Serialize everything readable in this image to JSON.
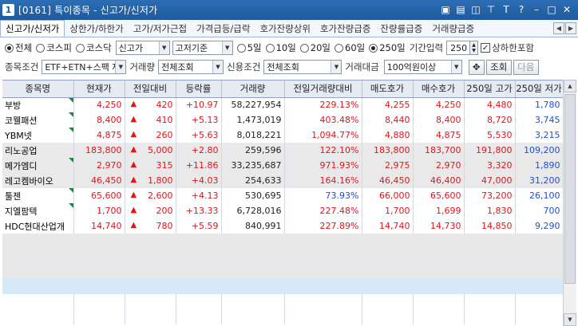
{
  "window": {
    "number": "1",
    "title": "[0161] 특이종목 - 신고가/신저가",
    "title_icons": [
      "monitor-icon",
      "clipboard-icon",
      "split-icon",
      "pin-icon",
      "T",
      "?",
      "minimize-icon",
      "maximize-icon",
      "close-icon"
    ]
  },
  "tabs": [
    {
      "label": "신고가/신저가",
      "active": true
    },
    {
      "label": "상한가/하한가"
    },
    {
      "label": "고가/저가근접"
    },
    {
      "label": "가격급등/급락"
    },
    {
      "label": "호가잔량상위"
    },
    {
      "label": "호가잔량급증"
    },
    {
      "label": "잔량률급증"
    },
    {
      "label": "거래량급증"
    }
  ],
  "filters": {
    "market_radios": [
      {
        "label": "전체",
        "checked": true
      },
      {
        "label": "코스피",
        "checked": false
      },
      {
        "label": "코스닥",
        "checked": false
      }
    ],
    "type_select": "신고가",
    "basis_select": "고저기준",
    "period_radios": [
      {
        "label": "5일",
        "checked": false
      },
      {
        "label": "10일",
        "checked": false
      },
      {
        "label": "20일",
        "checked": false
      },
      {
        "label": "60일",
        "checked": false
      },
      {
        "label": "250일",
        "checked": true
      }
    ],
    "period_input_label": "기간입력",
    "period_input_value": "250",
    "include_limit_label": "상하한포함",
    "include_limit_checked": true,
    "stock_condition_label": "종목조건",
    "stock_condition_value": "ETF+ETN+스팩 제",
    "volume_label": "거래량",
    "volume_value": "전체조회",
    "credit_label": "신용조건",
    "credit_value": "전체조회",
    "amount_label": "거래대금",
    "amount_value": "100억원이상",
    "search_button": "조회",
    "next_button": "다음"
  },
  "table": {
    "columns": [
      "종목명",
      "현재가",
      "전일대비",
      "등락률",
      "거래량",
      "전일거래량대비",
      "매도호가",
      "매수호가",
      "250일 고가",
      "250일 저가"
    ],
    "rows": [
      {
        "name": "부방",
        "price": "4,250",
        "change": "420",
        "rate": "+10.97",
        "volume": "58,227,954",
        "vol_ratio": "229.13%",
        "ask": "4,255",
        "bid": "4,250",
        "high": "4,480",
        "low": "1,780",
        "shade": false,
        "flag": true
      },
      {
        "name": "코웰패션",
        "price": "8,400",
        "change": "410",
        "rate": "+5.13",
        "volume": "1,473,019",
        "vol_ratio": "403.48%",
        "ask": "8,440",
        "bid": "8,400",
        "high": "8,720",
        "low": "3,745",
        "shade": false,
        "flag": true
      },
      {
        "name": "YBM넷",
        "price": "4,875",
        "change": "260",
        "rate": "+5.63",
        "volume": "8,018,221",
        "vol_ratio": "1,094.77%",
        "ask": "4,880",
        "bid": "4,875",
        "high": "5,530",
        "low": "3,215",
        "shade": false,
        "flag": true
      },
      {
        "name": "리노공업",
        "price": "183,800",
        "change": "5,000",
        "rate": "+2.80",
        "volume": "259,596",
        "vol_ratio": "122.10%",
        "ask": "183,800",
        "bid": "183,700",
        "high": "191,800",
        "low": "109,200",
        "shade": true,
        "flag": false
      },
      {
        "name": "메가엠디",
        "price": "2,970",
        "change": "315",
        "rate": "+11.86",
        "volume": "33,235,687",
        "vol_ratio": "971.93%",
        "ask": "2,975",
        "bid": "2,970",
        "high": "3,320",
        "low": "1,890",
        "shade": true,
        "flag": true
      },
      {
        "name": "레고켐바이오",
        "price": "46,450",
        "change": "1,800",
        "rate": "+4.03",
        "volume": "254,633",
        "vol_ratio": "164.16%",
        "ask": "46,450",
        "bid": "46,400",
        "high": "47,000",
        "low": "31,200",
        "shade": true,
        "flag": false
      },
      {
        "name": "툴젠",
        "price": "65,600",
        "change": "2,600",
        "rate": "+4.13",
        "volume": "530,695",
        "vol_ratio": "73.93%",
        "ask": "66,000",
        "bid": "65,600",
        "high": "73,200",
        "low": "26,100",
        "shade": false,
        "flag": true,
        "ratio_down": true
      },
      {
        "name": "지엘팜텍",
        "price": "1,700",
        "change": "200",
        "rate": "+13.33",
        "volume": "6,728,016",
        "vol_ratio": "227.48%",
        "ask": "1,700",
        "bid": "1,699",
        "high": "1,830",
        "low": "700",
        "shade": false,
        "flag": true
      },
      {
        "name": "HDC현대산업개",
        "price": "14,740",
        "change": "780",
        "rate": "+5.59",
        "volume": "840,991",
        "vol_ratio": "227.89%",
        "ask": "14,740",
        "bid": "14,730",
        "high": "14,850",
        "low": "9,290",
        "shade": false,
        "flag": false
      }
    ]
  },
  "colors": {
    "up": "#e3141a",
    "down": "#1c4fd6",
    "title_bar": "#1f5a9c",
    "flag": "#1a8a3a"
  }
}
